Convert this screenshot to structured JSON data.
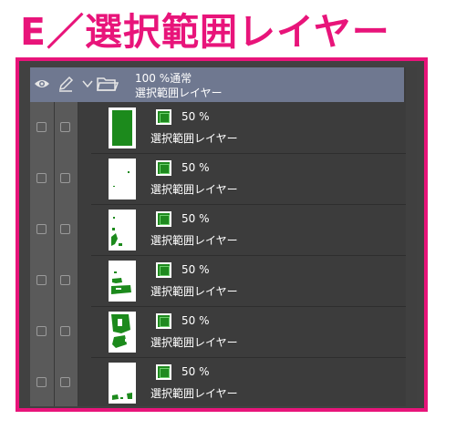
{
  "title": "E／選択範囲レイヤー",
  "folder": {
    "blend_line": "100 %通常",
    "name": "選択範囲レイヤー",
    "icons": [
      "eye-icon",
      "pen-icon",
      "chevron-down-icon",
      "folder-icon"
    ]
  },
  "layers": [
    {
      "opacity": "50 %",
      "name": "選択範囲レイヤー"
    },
    {
      "opacity": "50 %",
      "name": "選択範囲レイヤー"
    },
    {
      "opacity": "50 %",
      "name": "選択範囲レイヤー"
    },
    {
      "opacity": "50 %",
      "name": "選択範囲レイヤー"
    },
    {
      "opacity": "50 %",
      "name": "選択範囲レイヤー"
    },
    {
      "opacity": "50 %",
      "name": "選択範囲レイヤー"
    }
  ],
  "colors": {
    "accent": "#e8147a",
    "panel_bg": "#3c3c3c",
    "folder_row_bg": "#6f7890",
    "mask_green": "#1f8a1f",
    "thumb_green": "#1c8a1c"
  }
}
